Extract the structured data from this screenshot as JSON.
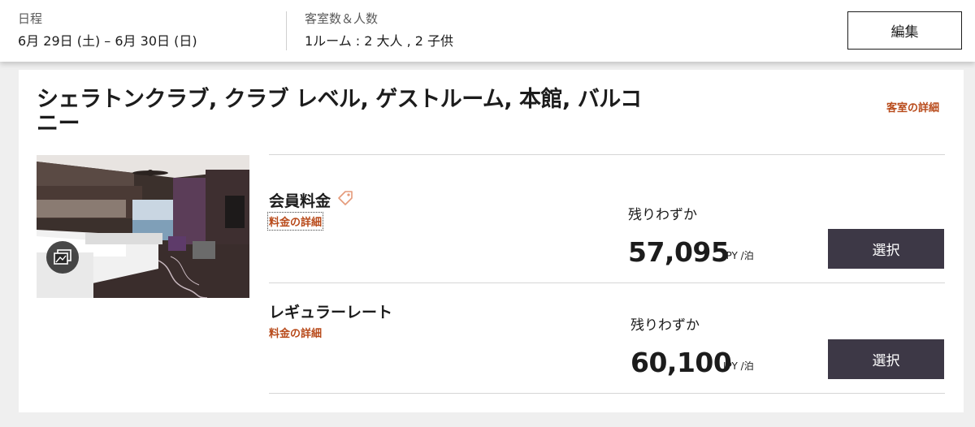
{
  "header": {
    "dates_label": "日程",
    "dates_value": "6月 29日 (土) – 6月 30日 (日)",
    "rooms_label": "客室数＆人数",
    "rooms_value": "1ルーム : 2 大人 , 2 子供",
    "edit_label": "編集"
  },
  "room": {
    "title_line1": "シェラトンクラブ, クラブ レベル, ゲストルーム, 本館, バルコ",
    "title_line2": "ニー",
    "details_link": "客室の詳細",
    "photo_icon": "gallery-icon"
  },
  "rates": [
    {
      "name": "会員料金",
      "icon": "tag-icon",
      "details_link": "料金の詳細",
      "availability": "残りわずか",
      "price": "57,095",
      "unit": "JPY /泊",
      "select_label": "選択"
    },
    {
      "name": "レギュラーレート",
      "details_link": "料金の詳細",
      "availability": "残りわずか",
      "price": "60,100",
      "unit": "JPY /泊",
      "select_label": "選択"
    }
  ],
  "colors": {
    "accent": "#b84a1a",
    "button": "#3d3846",
    "background": "#efefef"
  }
}
